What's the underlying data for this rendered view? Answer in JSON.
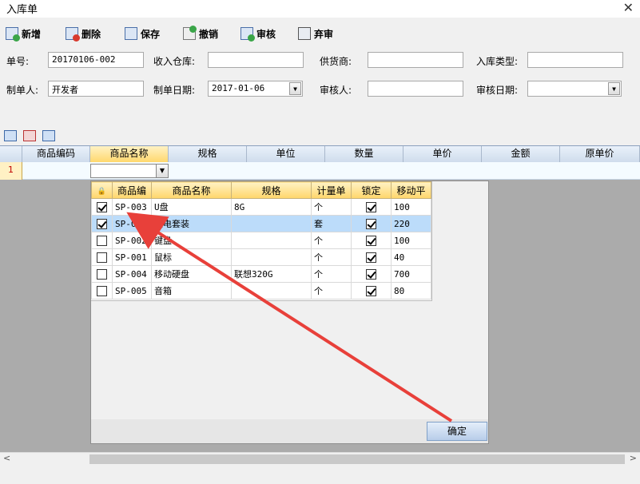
{
  "window": {
    "title": "入库单",
    "close_glyph": "✕"
  },
  "toolbar": {
    "new_label": "新增",
    "delete_label": "删除",
    "save_label": "保存",
    "undo_label": "撤销",
    "approve_label": "审核",
    "abandon_label": "弃审"
  },
  "form": {
    "order_no_label": "单号:",
    "order_no_value": "20170106-002",
    "warehouse_label": "收入仓库:",
    "warehouse_value": "",
    "supplier_label": "供货商:",
    "supplier_value": "",
    "type_label": "入库类型:",
    "type_value": "",
    "creator_label": "制单人:",
    "creator_value": "开发者",
    "date_label": "制单日期:",
    "date_value": "2017-01-06",
    "auditor_label": "审核人:",
    "auditor_value": "",
    "audit_date_label": "审核日期:",
    "audit_date_value": ""
  },
  "grid": {
    "columns": [
      "商品编码",
      "商品名称",
      "规格",
      "单位",
      "数量",
      "单价",
      "金额",
      "原单价"
    ],
    "row_number": "1"
  },
  "popup": {
    "columns": [
      "商品编",
      "商品名称",
      "规格",
      "计量单",
      "锁定",
      "移动平"
    ],
    "rows": [
      {
        "checked": true,
        "code": "SP-003",
        "name": "U盘",
        "spec": "8G",
        "unit": "个",
        "locked": true,
        "avg": "100"
      },
      {
        "checked": true,
        "code": "SP-006",
        "name": "光电套装",
        "spec": "",
        "unit": "套",
        "locked": true,
        "avg": "220"
      },
      {
        "checked": false,
        "code": "SP-002",
        "name": "键盘",
        "spec": "",
        "unit": "个",
        "locked": true,
        "avg": "100"
      },
      {
        "checked": false,
        "code": "SP-001",
        "name": "鼠标",
        "spec": "",
        "unit": "个",
        "locked": true,
        "avg": "40"
      },
      {
        "checked": false,
        "code": "SP-004",
        "name": "移动硬盘",
        "spec": "联想320G",
        "unit": "个",
        "locked": true,
        "avg": "700"
      },
      {
        "checked": false,
        "code": "SP-005",
        "name": "音箱",
        "spec": "",
        "unit": "个",
        "locked": true,
        "avg": "80"
      }
    ],
    "selected_row": 1,
    "ok_label": "确定"
  },
  "colors": {
    "annotation_arrow": "#e8403a",
    "header_active": "#ffd86e",
    "selection": "#bcdcfa"
  }
}
